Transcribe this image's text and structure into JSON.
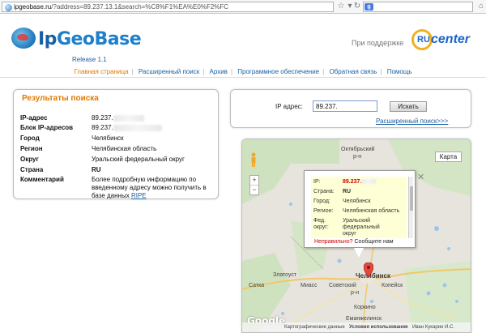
{
  "browser": {
    "url_domain": "ipgeobase.ru",
    "url_rest": "/?address=89.237.13.1&search=%C8%F1%EA%E0%F2%FC",
    "search_engine_icon": "google-icon"
  },
  "header": {
    "logo_text_a": "Ip",
    "logo_text_b": "GeoBase",
    "release": "Release 1.1",
    "support_text": "При поддержке",
    "partner_logo_ru": "RU",
    "partner_logo_text": "center"
  },
  "nav": {
    "items": [
      {
        "label": "Главная страница",
        "active": true
      },
      {
        "label": "Расширенный поиск"
      },
      {
        "label": "Архив"
      },
      {
        "label": "Программное обеспечение"
      },
      {
        "label": "Обратная связь"
      },
      {
        "label": "Помощь"
      }
    ]
  },
  "results": {
    "title": "Результаты поиска",
    "rows": [
      {
        "key": "IP-адрес",
        "value": "89.237."
      },
      {
        "key": "Блок IP-адресов",
        "value": "89.237."
      },
      {
        "key": "Город",
        "value": "Челябинск"
      },
      {
        "key": "Регион",
        "value": "Челябинская область"
      },
      {
        "key": "Округ",
        "value": "Уральский федеральный округ"
      },
      {
        "key": "Страна",
        "value": "RU"
      },
      {
        "key": "Комментарий",
        "value": "Более подробную информацию по введенному адресу можно получить в базе данных "
      }
    ],
    "ripe_link": "RIPE"
  },
  "search": {
    "label": "IP адрес:",
    "value": "89.237.",
    "button": "Искать",
    "advanced_link": "Расширенный поиск>>>"
  },
  "map": {
    "type_button": "Карта",
    "zoom_in": "+",
    "zoom_out": "−",
    "cities": {
      "oktyabrsky": "Октябрьский",
      "rn1": "р-н",
      "zlatoust": "Златоуст",
      "miass": "Миасс",
      "satka": "Сатка",
      "sovetsky": "Советский",
      "rn2": "р-н",
      "chelyabinsk": "Челябинск",
      "kopeysk": "Копейск",
      "korkino": "Коркино",
      "emanzhelinsk": "Еманжелинск"
    },
    "popup": {
      "rows": [
        {
          "key": "IP:",
          "value": "89.237."
        },
        {
          "key": "Страна:",
          "value": "RU"
        },
        {
          "key": "Город:",
          "value": "Челябинск"
        },
        {
          "key": "Регион:",
          "value": "Челябинская область"
        },
        {
          "key": "Фед. округ:",
          "value": "Уральский федеральный округ"
        }
      ],
      "wrong_text": "Неправильно?",
      "report_text": "Сообщите нам",
      "close_icon": "close-icon"
    },
    "footer": {
      "google": "Google",
      "data": "Картографические данные",
      "terms": "Условия использования",
      "extra": "Иван Кукарин И.С."
    }
  }
}
